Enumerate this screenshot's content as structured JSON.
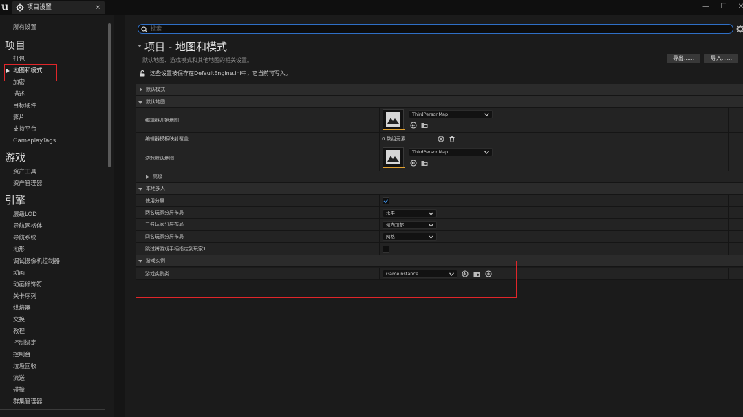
{
  "window": {
    "logo": "u",
    "tab_title": "项目设置",
    "tab_close": "×",
    "min_label": "—",
    "max_label": "☐",
    "close_label": "✕"
  },
  "sidebar": {
    "all_settings": "所有设置",
    "sections": [
      {
        "heading": "项目",
        "items": [
          "打包",
          "地图和模式",
          "加密",
          "描述",
          "目标硬件",
          "影片",
          "支持平台",
          "GameplayTags"
        ]
      },
      {
        "heading": "游戏",
        "items": [
          "资产工具",
          "资产管理器"
        ]
      },
      {
        "heading": "引擎",
        "items": [
          "层级LOD",
          "导航网格体",
          "导航系统",
          "地形",
          "调试摄像机控制器",
          "动画",
          "动画修饰符",
          "关卡序列",
          "烘焙器",
          "交换",
          "教程",
          "控制绑定",
          "控制台",
          "垃圾回收",
          "流送",
          "碰撞",
          "群集管理器"
        ]
      }
    ],
    "active_item": "地图和模式"
  },
  "search": {
    "placeholder": "搜索"
  },
  "header": {
    "title": "项目 - 地图和模式",
    "subtitle": "默认地图、游戏模式和其他地图的相关设置。",
    "export_label": "导出......",
    "import_label": "导入......",
    "config_note": "这些设置被保存在DefaultEngine.ini中，它当前可写入。"
  },
  "categories": {
    "default_modes": "默认模式",
    "default_maps": "默认地图",
    "advanced": "高级",
    "local_multiplayer": "本地多人",
    "game_instance": "游戏实例"
  },
  "properties": {
    "editor_startup_map": {
      "name": "编辑器开始地图",
      "value": "ThirdPersonMap"
    },
    "editor_template_overrides": {
      "name": "编辑器模板映射覆盖",
      "value": "0 数组元素"
    },
    "game_default_map": {
      "name": "游戏默认地图",
      "value": "ThirdPersonMap"
    },
    "use_splitscreen": {
      "name": "使用分屏",
      "checked": true
    },
    "two_player_layout": {
      "name": "两名玩家分屏布局",
      "value": "水平"
    },
    "three_player_layout": {
      "name": "三名玩家分屏布局",
      "value": "倾向顶部"
    },
    "four_player_layout": {
      "name": "四名玩家分屏布局",
      "value": "网格"
    },
    "skip_first_controller": {
      "name": "跳过将游戏手柄指定到玩家1",
      "checked": false
    },
    "game_instance_class": {
      "name": "游戏实例类",
      "value": "GameInstance"
    }
  },
  "colors": {
    "accent_blue": "#2f6fc6",
    "highlight_red": "#e0262a",
    "asset_orange": "#e0a030"
  }
}
